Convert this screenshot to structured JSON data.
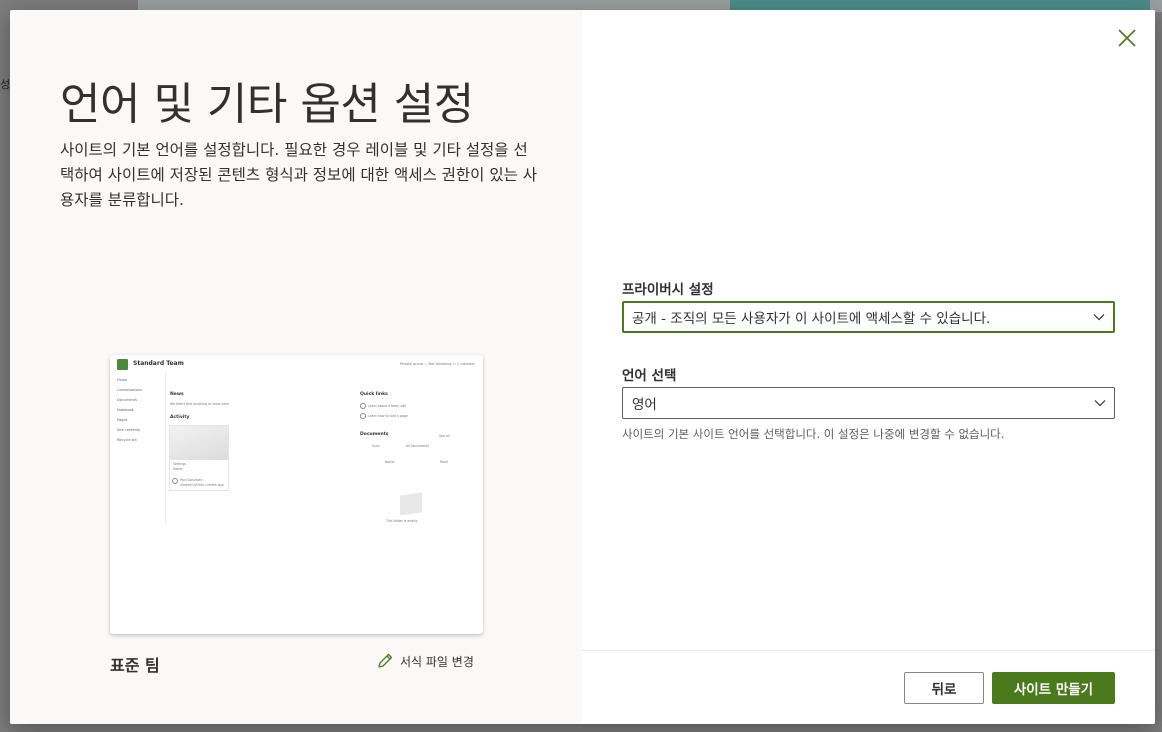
{
  "backdrop": {
    "edge_text": "성"
  },
  "modal": {
    "title": "언어 및 기타 옵션 설정",
    "description": "사이트의 기본 언어를 설정합니다. 필요한 경우 레이블 및 기타 설정을 선택하여 사이트에 저장된 콘텐츠 형식과 정보에 대한 액세스 권한이 있는 사용자를 분류합니다.",
    "preview": {
      "site_name": "Standard Team",
      "top_bar": "Private group  ☆ Not following  ⚇ 1 member",
      "nav": [
        "Home",
        "Conversations",
        "Documents",
        "Notebook",
        "Pages",
        "Site contents",
        "Recycle bin"
      ],
      "news_heading": "News",
      "news_text": "We didn't find anything to show here.",
      "activity_heading": "Activity",
      "activity_card_title": "Settings",
      "activity_card_sub": "Home",
      "activity_person": "Paul Gonzalez",
      "activity_person_sub": "Viewed list this current app",
      "quicklinks_heading": "Quick links",
      "quicklinks": [
        "Learn about a team site",
        "Learn how to add a page"
      ],
      "documents_heading": "Documents",
      "documents_see_all": "See all",
      "documents_sync": "Sync",
      "documents_filter": "All Documents",
      "documents_name_col": "Name",
      "documents_modified_col": "Modi",
      "empty_text": "This folder is empty"
    },
    "template_name": "표준 팀",
    "change_template_label": "서식 파일 변경",
    "privacy": {
      "label": "프라이버시 설정",
      "selected": "공개 - 조직의 모든 사용자가 이 사이트에 액세스할 수 있습니다."
    },
    "language": {
      "label": "언어 선택",
      "selected": "영어",
      "helper": "사이트의 기본 사이트 언어를 선택합니다. 이 설정은 나중에 변경할 수 없습니다."
    },
    "buttons": {
      "back": "뒤로",
      "create": "사이트 만들기"
    }
  },
  "colors": {
    "accent": "#4a7a1c",
    "border": "#605e5c"
  }
}
